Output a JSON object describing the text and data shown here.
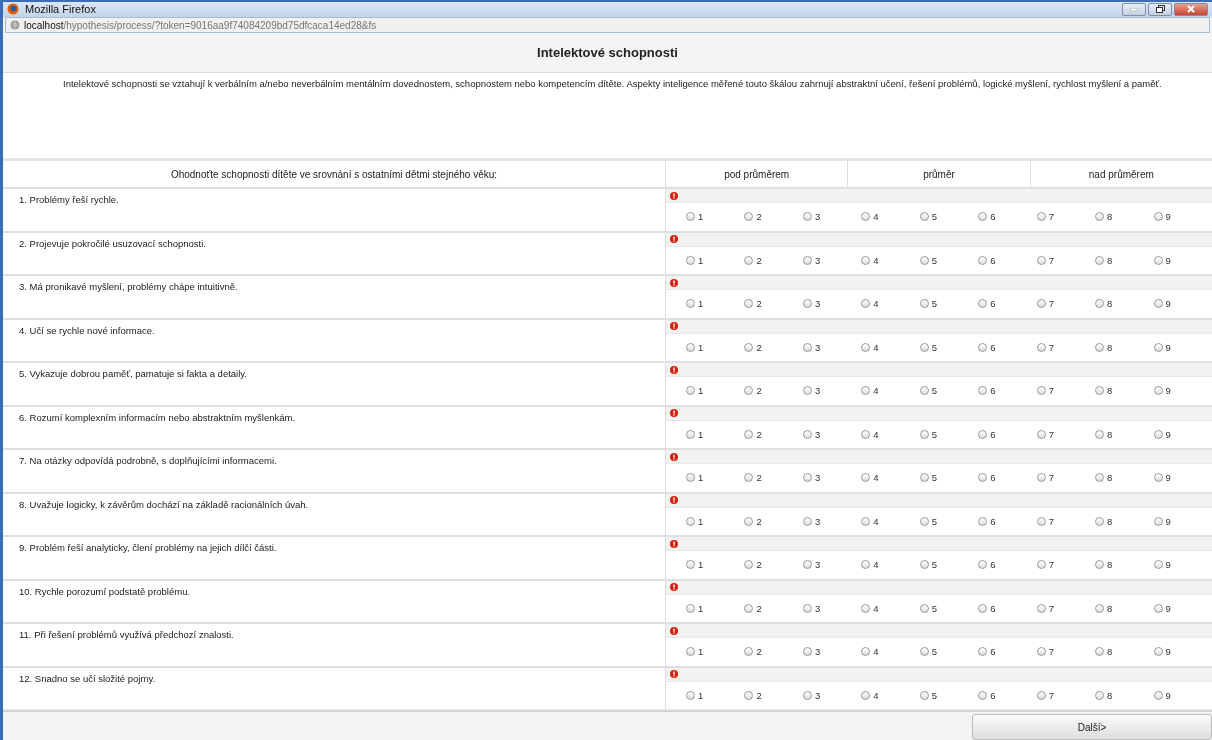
{
  "window": {
    "title": "Mozilla Firefox"
  },
  "address_bar": {
    "host": "localhost",
    "path": "/hypothesis/process/?token=9016aa9f74084209bd75dfcaca14ed28&fs"
  },
  "page_title": "Intelektové schopnosti",
  "description": "Intelektové schopnosti se vztahují k verbálním a/nebo neverbálním mentálním dovednostem, schopnostem nebo kompetencím dítěte. Aspekty inteligence měřené touto škálou zahrnují abstraktní učení, řešení problémů, logické myšlení, rychlost myšlení a paměť.",
  "table": {
    "instruction": "Ohodnoťte schopnosti dítěte ve srovnání s ostatními dětmi stejného věku:",
    "groups": [
      "pod průměrem",
      "průměr",
      "nad průměrem"
    ],
    "rows": [
      {
        "question": "1. Problémy řeší rychle.",
        "required_warning": true,
        "options": [
          {
            "label": "1",
            "selected": false
          },
          {
            "label": "2",
            "selected": false
          },
          {
            "label": "3",
            "selected": false
          },
          {
            "label": "4",
            "selected": false
          },
          {
            "label": "5",
            "selected": false
          },
          {
            "label": "6",
            "selected": false
          },
          {
            "label": "7",
            "selected": false
          },
          {
            "label": "8",
            "selected": false
          },
          {
            "label": "9",
            "selected": false
          }
        ]
      },
      {
        "question": "2. Projevuje pokročilé usuzovací schopnosti.",
        "required_warning": true,
        "options": [
          {
            "label": "1",
            "selected": false
          },
          {
            "label": "2",
            "selected": false
          },
          {
            "label": "3",
            "selected": false
          },
          {
            "label": "4",
            "selected": false
          },
          {
            "label": "5",
            "selected": false
          },
          {
            "label": "6",
            "selected": false
          },
          {
            "label": "7",
            "selected": false
          },
          {
            "label": "8",
            "selected": false
          },
          {
            "label": "9",
            "selected": false
          }
        ]
      },
      {
        "question": "3. Má pronikavé myšlení, problémy chápe intuitivně.",
        "required_warning": true,
        "options": [
          {
            "label": "1",
            "selected": false
          },
          {
            "label": "2",
            "selected": false
          },
          {
            "label": "3",
            "selected": false
          },
          {
            "label": "4",
            "selected": false
          },
          {
            "label": "5",
            "selected": false
          },
          {
            "label": "6",
            "selected": false
          },
          {
            "label": "7",
            "selected": false
          },
          {
            "label": "8",
            "selected": false
          },
          {
            "label": "9",
            "selected": false
          }
        ]
      },
      {
        "question": "4. Učí se rychle nové informace.",
        "required_warning": true,
        "options": [
          {
            "label": "1",
            "selected": false
          },
          {
            "label": "2",
            "selected": false
          },
          {
            "label": "3",
            "selected": false
          },
          {
            "label": "4",
            "selected": false
          },
          {
            "label": "5",
            "selected": false
          },
          {
            "label": "6",
            "selected": false
          },
          {
            "label": "7",
            "selected": false
          },
          {
            "label": "8",
            "selected": false
          },
          {
            "label": "9",
            "selected": false
          }
        ]
      },
      {
        "question": "5. Vykazuje dobrou paměť, pamatuje si fakta a detaily.",
        "required_warning": true,
        "options": [
          {
            "label": "1",
            "selected": false
          },
          {
            "label": "2",
            "selected": false
          },
          {
            "label": "3",
            "selected": false
          },
          {
            "label": "4",
            "selected": false
          },
          {
            "label": "5",
            "selected": false
          },
          {
            "label": "6",
            "selected": false
          },
          {
            "label": "7",
            "selected": false
          },
          {
            "label": "8",
            "selected": false
          },
          {
            "label": "9",
            "selected": false
          }
        ]
      },
      {
        "question": "6. Rozumí komplexním informacím nebo abstraktním myšlenkám.",
        "required_warning": true,
        "options": [
          {
            "label": "1",
            "selected": false
          },
          {
            "label": "2",
            "selected": false
          },
          {
            "label": "3",
            "selected": false
          },
          {
            "label": "4",
            "selected": false
          },
          {
            "label": "5",
            "selected": false
          },
          {
            "label": "6",
            "selected": false
          },
          {
            "label": "7",
            "selected": false
          },
          {
            "label": "8",
            "selected": false
          },
          {
            "label": "9",
            "selected": false
          }
        ]
      },
      {
        "question": "7. Na otázky odpovídá podrobně, s doplňujícími informacemi.",
        "required_warning": true,
        "options": [
          {
            "label": "1",
            "selected": false
          },
          {
            "label": "2",
            "selected": false
          },
          {
            "label": "3",
            "selected": false
          },
          {
            "label": "4",
            "selected": false
          },
          {
            "label": "5",
            "selected": false
          },
          {
            "label": "6",
            "selected": false
          },
          {
            "label": "7",
            "selected": false
          },
          {
            "label": "8",
            "selected": false
          },
          {
            "label": "9",
            "selected": false
          }
        ]
      },
      {
        "question": "8. Uvažuje logicky, k závěrům dochází na základě racionálních úvah.",
        "required_warning": true,
        "options": [
          {
            "label": "1",
            "selected": false
          },
          {
            "label": "2",
            "selected": false
          },
          {
            "label": "3",
            "selected": false
          },
          {
            "label": "4",
            "selected": false
          },
          {
            "label": "5",
            "selected": false
          },
          {
            "label": "6",
            "selected": false
          },
          {
            "label": "7",
            "selected": false
          },
          {
            "label": "8",
            "selected": false
          },
          {
            "label": "9",
            "selected": false
          }
        ]
      },
      {
        "question": "9. Problém řeší analyticky, člení problémy na jejich dílčí části.",
        "required_warning": true,
        "options": [
          {
            "label": "1",
            "selected": false
          },
          {
            "label": "2",
            "selected": false
          },
          {
            "label": "3",
            "selected": false
          },
          {
            "label": "4",
            "selected": false
          },
          {
            "label": "5",
            "selected": false
          },
          {
            "label": "6",
            "selected": false
          },
          {
            "label": "7",
            "selected": false
          },
          {
            "label": "8",
            "selected": false
          },
          {
            "label": "9",
            "selected": false
          }
        ]
      },
      {
        "question": "10. Rychle porozumí podstatě problému.",
        "required_warning": true,
        "options": [
          {
            "label": "1",
            "selected": false
          },
          {
            "label": "2",
            "selected": false
          },
          {
            "label": "3",
            "selected": false
          },
          {
            "label": "4",
            "selected": false
          },
          {
            "label": "5",
            "selected": false
          },
          {
            "label": "6",
            "selected": false
          },
          {
            "label": "7",
            "selected": false
          },
          {
            "label": "8",
            "selected": false
          },
          {
            "label": "9",
            "selected": false
          }
        ]
      },
      {
        "question": "11. Při řešení problémů využívá předchozí znalosti.",
        "required_warning": true,
        "options": [
          {
            "label": "1",
            "selected": false
          },
          {
            "label": "2",
            "selected": false
          },
          {
            "label": "3",
            "selected": false
          },
          {
            "label": "4",
            "selected": false
          },
          {
            "label": "5",
            "selected": false
          },
          {
            "label": "6",
            "selected": false
          },
          {
            "label": "7",
            "selected": false
          },
          {
            "label": "8",
            "selected": false
          },
          {
            "label": "9",
            "selected": false
          }
        ]
      },
      {
        "question": "12. Snadno se učí složité pojmy.",
        "required_warning": true,
        "options": [
          {
            "label": "1",
            "selected": false
          },
          {
            "label": "2",
            "selected": false
          },
          {
            "label": "3",
            "selected": false
          },
          {
            "label": "4",
            "selected": false
          },
          {
            "label": "5",
            "selected": false
          },
          {
            "label": "6",
            "selected": false
          },
          {
            "label": "7",
            "selected": false
          },
          {
            "label": "8",
            "selected": false
          },
          {
            "label": "9",
            "selected": false
          }
        ]
      }
    ]
  },
  "next_button": "Další>"
}
